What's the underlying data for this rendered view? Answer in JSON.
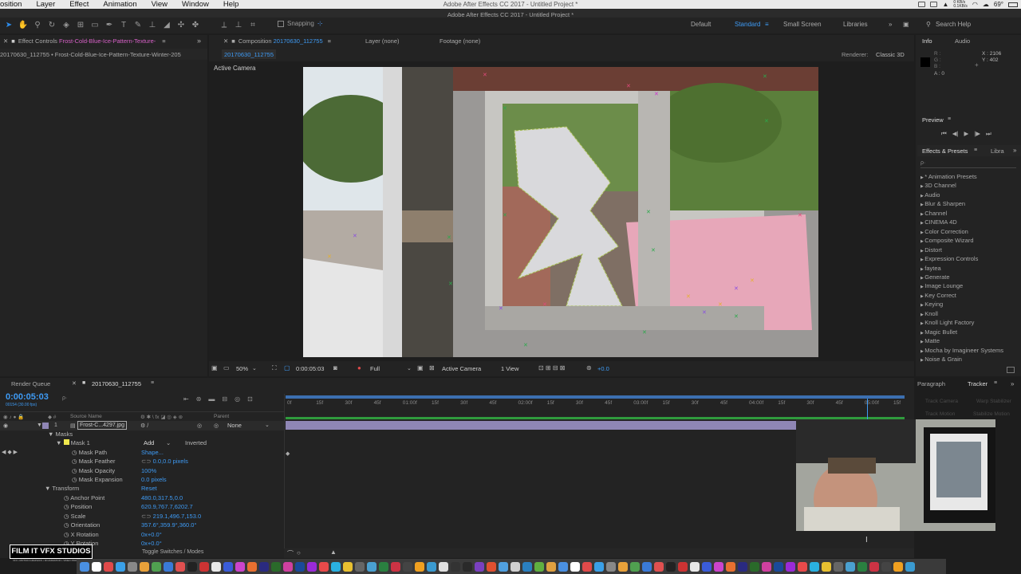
{
  "menubar": {
    "items": [
      "osition",
      "Layer",
      "Effect",
      "Animation",
      "View",
      "Window",
      "Help"
    ],
    "title": "Adobe After Effects CC 2017 - Untitled Project *",
    "net_up": "0 KB/s",
    "net_down": "0.1KB/s",
    "temp": "69°"
  },
  "toolbar": {
    "snapping_label": "Snapping",
    "workspaces": [
      "Default",
      "Standard",
      "Small Screen",
      "Libraries"
    ],
    "search_label": "Search Help"
  },
  "effect_controls": {
    "tab_prefix": "Effect Controls",
    "tab_layer": "Frost-Cold-Blue-Ice-Pattern-Texture-",
    "subtitle": "20170630_112755 • Frost-Cold-Blue-Ice-Pattern-Texture-Winter-205"
  },
  "composition": {
    "tab_prefix": "Composition",
    "tab_name": "20170630_112755",
    "layer_tab": "Layer (none)",
    "footage_tab": "Footage (none)",
    "comp_name": "20170630_112755",
    "renderer_label": "Renderer:",
    "renderer_value": "Classic 3D",
    "camera_label": "Active Camera"
  },
  "viewer_controls": {
    "zoom": "50%",
    "timecode": "0:00:05:03",
    "resolution": "Full",
    "camera": "Active Camera",
    "views": "1 View",
    "exposure": "+0.0"
  },
  "info": {
    "tab": "Info",
    "audio_tab": "Audio",
    "r_label": "R :",
    "g_label": "G :",
    "b_label": "B :",
    "a_label": "A : 0",
    "x": "X : 2106",
    "y": "Y : 402"
  },
  "preview": {
    "tab": "Preview"
  },
  "effects": {
    "tab": "Effects & Presets",
    "libra_tab": "Libra",
    "search_glyph": "ρ·",
    "items": [
      "* Animation Presets",
      "3D Channel",
      "Audio",
      "Blur & Sharpen",
      "Channel",
      "CINEMA 4D",
      "Color Correction",
      "Composite Wizard",
      "Distort",
      "Expression Controls",
      "faytea",
      "Generate",
      "Image Lounge",
      "Key Correct",
      "Keying",
      "Knoll",
      "Knoll Light Factory",
      "Magic Bullet",
      "Matte",
      "Mocha by Imagineer Systems",
      "Noise & Grain"
    ]
  },
  "timeline": {
    "render_queue_tab": "Render Queue",
    "comp_tab": "20170630_112755",
    "timecode": "0:00:05:03",
    "fps_info": "00154 (30.00 fps)",
    "search_glyph": "ρ·",
    "col_source": "Source Name",
    "col_parent": "Parent",
    "layer_number": "1",
    "layer_name": "Frost-C...4297.jpg",
    "parent_value": "None",
    "masks_label": "Masks",
    "mask1_label": "Mask 1",
    "mask_mode": "Add",
    "inverted_label": "Inverted",
    "properties": [
      {
        "name": "Mask Path",
        "value": "Shape..."
      },
      {
        "name": "Mask Feather",
        "value": "0.0,0.0 pixels"
      },
      {
        "name": "Mask Opacity",
        "value": "100%"
      },
      {
        "name": "Mask Expansion",
        "value": "0.0 pixels"
      }
    ],
    "transform_label": "Transform",
    "reset_label": "Reset",
    "transform_props": [
      {
        "name": "Anchor Point",
        "value": "480.0,317.5,0.0"
      },
      {
        "name": "Position",
        "value": "620.9,767.7,6202.7"
      },
      {
        "name": "Scale",
        "value": "219.1,496.7,153.0"
      },
      {
        "name": "Orientation",
        "value": "357.6°,359.9°,360.0°"
      },
      {
        "name": "X Rotation",
        "value": "0x+0.0°"
      },
      {
        "name": "Y Rotation",
        "value": "0x+0.0°"
      }
    ],
    "toggle_label": "Toggle Switches / Modes",
    "ruler_labels": [
      "0f",
      "15f",
      "30f",
      "45f",
      "01:00f",
      "15f",
      "30f",
      "45f",
      "02:00f",
      "15f",
      "30f",
      "45f",
      "03:00f",
      "15f",
      "30f",
      "45f",
      "04:00f",
      "15f",
      "30f",
      "45f",
      "05:00f",
      "15f"
    ],
    "playhead_fraction": 0.94
  },
  "right_lower": {
    "paragraph_tab": "Paragraph",
    "tracker_tab": "Tracker",
    "ghost_lines": [
      "Track Camera",
      "Warp Stabilizer",
      "Track Motion",
      "Stabilize Motion"
    ]
  },
  "watermark": {
    "line1": "FILM IT VFX STUDIOS",
    "line2": "VFX • MOTION GRAPHICS • 3D ANIMATION • VIDEO PRODUCTION"
  },
  "colors": {
    "accent_blue": "#2d8ceb",
    "panel_bg": "#232323",
    "layer_bar": "#8f86b5",
    "mask_shape": "#c8c8cc",
    "pink_sheet": "#e7a7b9"
  }
}
